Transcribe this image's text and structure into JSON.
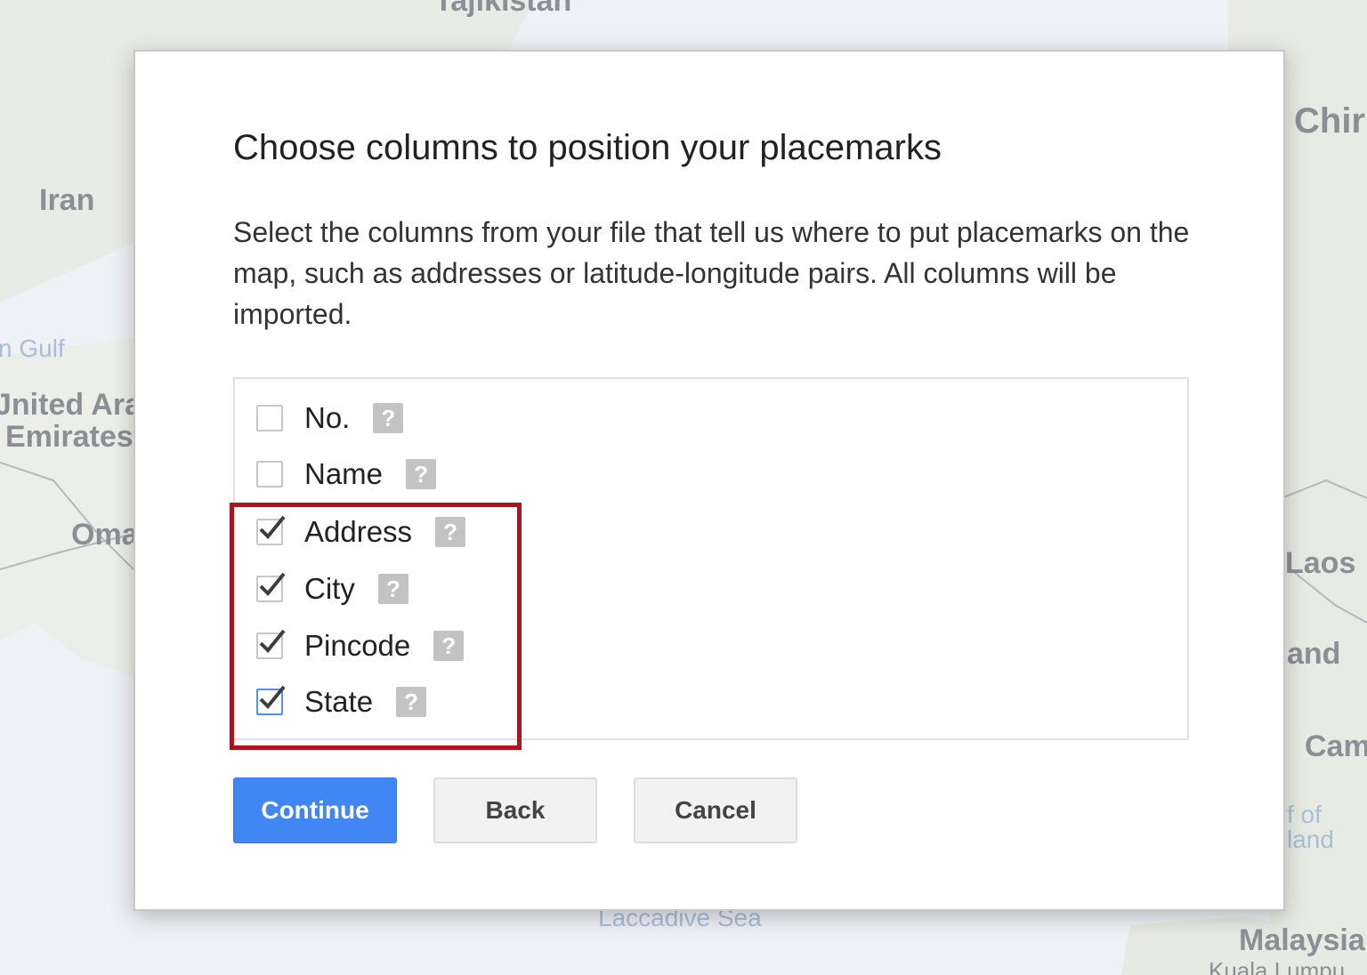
{
  "map": {
    "labels": {
      "tajikistan": "Tajikistan",
      "iran": "Iran",
      "gulf": "n Gulf",
      "uae_line1": "Jnited Ara",
      "uae_line2": "Emirates",
      "oman": "Oma",
      "china": "Chir",
      "laos": "Laos",
      "thailand": "and",
      "cambodia": "Cam",
      "gulf_of_line1": "f of",
      "gulf_of_line2": "land",
      "laccadive_sea": "Laccadive Sea",
      "malaysia": "Malaysia",
      "kuala_lumpur": "Kuala Lumpu"
    }
  },
  "dialog": {
    "title": "Choose columns to position your placemarks",
    "description": "Select the columns from your file that tell us where to put placemarks on the map, such as addresses or latitude-longitude pairs. All columns will be imported.",
    "columns": [
      {
        "label": "No.",
        "checked": false
      },
      {
        "label": "Name",
        "checked": false
      },
      {
        "label": "Address",
        "checked": true
      },
      {
        "label": "City",
        "checked": true
      },
      {
        "label": "Pincode",
        "checked": true
      },
      {
        "label": "State",
        "checked": true
      }
    ],
    "help_glyph": "?",
    "buttons": {
      "continue": "Continue",
      "back": "Back",
      "cancel": "Cancel"
    }
  },
  "colors": {
    "primary": "#4285f4",
    "highlight": "#b0111b"
  }
}
